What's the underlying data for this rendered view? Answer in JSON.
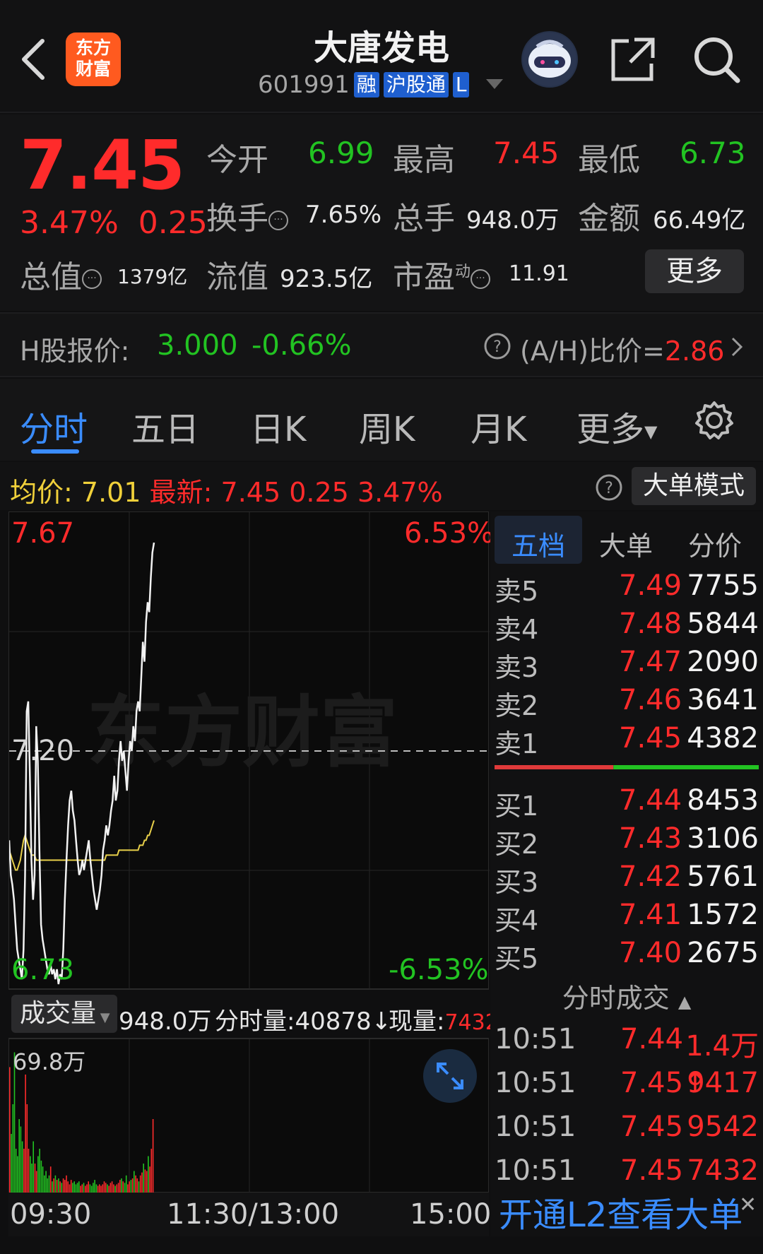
{
  "header": {
    "logo_line1": "东方",
    "logo_line2": "财富",
    "stock_name": "大唐发电",
    "stock_code": "601991",
    "badge1": "融",
    "badge2": "沪股通",
    "badge3": "L"
  },
  "quote": {
    "price": "7.45",
    "change_pct": "3.47%",
    "change_abs": "0.25",
    "open_label": "今开",
    "open": "6.99",
    "high_label": "最高",
    "high": "7.45",
    "low_label": "最低",
    "low": "6.73",
    "turnover_label": "换手",
    "turnover": "7.65%",
    "volume_label": "总手",
    "volume": "948.0万",
    "amount_label": "金额",
    "amount": "66.49亿",
    "mktcap_label": "总值",
    "mktcap": "1379亿",
    "float_label": "流值",
    "float": "923.5亿",
    "pe_label": "市盈",
    "pe_sup": "动",
    "pe": "11.91",
    "more": "更多"
  },
  "hk": {
    "label": "H股报价:",
    "price": "3.000",
    "pct": "-0.66%",
    "ratio_label": "(A/H)比价=",
    "ratio": "2.86"
  },
  "tabs": [
    "分时",
    "五日",
    "日K",
    "周K",
    "月K",
    "更多"
  ],
  "avg_row": {
    "avg_label": "均价:",
    "avg": "7.01",
    "latest_label": "最新:",
    "latest": "7.45",
    "chg": "0.25",
    "pct": "3.47%",
    "big_order_mode": "大单模式"
  },
  "chart_axes": {
    "top_price": "7.67",
    "mid_price": "7.20",
    "bottom_price": "6.73",
    "top_pct": "6.53%",
    "bottom_pct": "-6.53%",
    "watermark": "东方财富"
  },
  "chart_data": {
    "type": "line",
    "ylim": [
      6.73,
      7.67
    ],
    "x_points": 240,
    "series": [
      {
        "values": [
          7.02,
          6.95,
          6.93,
          6.9,
          6.85,
          6.8,
          6.78,
          6.76,
          6.74,
          6.8,
          6.95,
          7.28,
          7.3,
          7.15,
          6.98,
          6.9,
          6.95,
          7.25,
          7.18,
          7.0,
          6.85,
          6.82,
          6.8,
          6.78,
          6.76,
          6.75,
          6.77,
          6.75,
          6.76,
          6.74,
          6.76,
          6.73,
          6.75,
          6.74,
          6.8,
          6.9,
          6.98,
          7.05,
          7.1,
          7.12,
          7.08,
          7.06,
          7.02,
          6.98,
          6.95,
          6.96,
          6.98,
          6.96,
          6.98,
          7.0,
          7.02,
          6.98,
          6.95,
          6.92,
          6.9,
          6.88,
          6.9,
          6.92,
          6.95,
          7.0,
          7.02,
          7.05,
          7.03,
          7.05,
          7.08,
          7.1,
          7.15,
          7.1,
          7.12,
          7.18,
          7.22,
          7.18,
          7.2,
          7.16,
          7.12,
          7.18,
          7.22,
          7.2,
          7.25,
          7.22,
          7.28,
          7.3,
          7.28,
          7.35,
          7.42,
          7.38,
          7.46,
          7.5,
          7.48,
          7.55,
          7.6,
          7.62
        ]
      },
      {
        "values": [
          7.0,
          6.99,
          6.98,
          6.97,
          6.96,
          6.96,
          6.97,
          6.98,
          7.0,
          7.02,
          7.03,
          7.02,
          7.01,
          7.0,
          6.99,
          6.99,
          6.99,
          6.98,
          6.98,
          6.98,
          6.98,
          6.98,
          6.98,
          6.98,
          6.98,
          6.98,
          6.98,
          6.98,
          6.98,
          6.98,
          6.98,
          6.98,
          6.98,
          6.98,
          6.98,
          6.98,
          6.98,
          6.98,
          6.98,
          6.98,
          6.98,
          6.98,
          6.98,
          6.98,
          6.98,
          6.98,
          6.98,
          6.98,
          6.98,
          6.98,
          6.98,
          6.98,
          6.98,
          6.98,
          6.98,
          6.98,
          6.98,
          6.98,
          6.98,
          6.98,
          6.98,
          6.99,
          6.99,
          6.99,
          6.99,
          6.99,
          6.99,
          6.99,
          6.99,
          7.0,
          7.0,
          7.0,
          7.0,
          7.0,
          7.0,
          7.0,
          7.0,
          7.0,
          7.0,
          7.0,
          7.0,
          7.0,
          7.01,
          7.01,
          7.01,
          7.02,
          7.02,
          7.03,
          7.03,
          7.04,
          7.05,
          7.06
        ]
      }
    ],
    "volume": [
      0.85,
      0.4,
      0.6,
      0.95,
      0.3,
      0.25,
      0.5,
      0.45,
      0.35,
      0.3,
      0.8,
      0.6,
      0.3,
      0.25,
      0.2,
      0.35,
      0.2,
      0.15,
      0.25,
      0.3,
      0.22,
      0.18,
      0.12,
      0.15,
      0.1,
      0.12,
      0.18,
      0.08,
      0.1,
      0.12,
      0.09,
      0.1,
      0.08,
      0.07,
      0.1,
      0.09,
      0.12,
      0.08,
      0.06,
      0.09,
      0.07,
      0.08,
      0.06,
      0.07,
      0.08,
      0.05,
      0.06,
      0.07,
      0.05,
      0.06,
      0.08,
      0.06,
      0.05,
      0.07,
      0.09,
      0.06,
      0.05,
      0.06,
      0.05,
      0.06,
      0.08,
      0.07,
      0.06,
      0.05,
      0.07,
      0.08,
      0.06,
      0.05,
      0.06,
      0.07,
      0.09,
      0.1,
      0.08,
      0.07,
      0.12,
      0.06,
      0.08,
      0.09,
      0.1,
      0.15,
      0.12,
      0.1,
      0.08,
      0.12,
      0.14,
      0.2,
      0.16,
      0.15,
      0.25,
      0.18,
      0.3,
      0.5
    ]
  },
  "volume_panel": {
    "selector": "成交量",
    "total": "948.0万",
    "minute_vol": "分时量:40878↓",
    "current_label": "现量:",
    "current": "7432",
    "max": "69.8万"
  },
  "time_axis": [
    "09:30",
    "11:30/13:00",
    "15:00"
  ],
  "book": {
    "tabs": [
      "五档",
      "大单",
      "分价"
    ],
    "asks": [
      {
        "label": "卖5",
        "price": "7.49",
        "vol": "7755"
      },
      {
        "label": "卖4",
        "price": "7.48",
        "vol": "5844"
      },
      {
        "label": "卖3",
        "price": "7.47",
        "vol": "2090"
      },
      {
        "label": "卖2",
        "price": "7.46",
        "vol": "3641"
      },
      {
        "label": "卖1",
        "price": "7.45",
        "vol": "4382"
      }
    ],
    "bids": [
      {
        "label": "买1",
        "price": "7.44",
        "vol": "8453"
      },
      {
        "label": "买2",
        "price": "7.43",
        "vol": "3106"
      },
      {
        "label": "买3",
        "price": "7.42",
        "vol": "5761"
      },
      {
        "label": "买4",
        "price": "7.41",
        "vol": "1572"
      },
      {
        "label": "买5",
        "price": "7.40",
        "vol": "2675"
      }
    ],
    "ask_bid_ratio": 0.45,
    "trades_title": "分时成交",
    "trades": [
      {
        "time": "10:51",
        "price": "7.44",
        "vol": "1.4万"
      },
      {
        "time": "10:51",
        "price": "7.45↑",
        "vol": "9417"
      },
      {
        "time": "10:51",
        "price": "7.45",
        "vol": "9542"
      },
      {
        "time": "10:51",
        "price": "7.45",
        "vol": "7432"
      }
    ],
    "l2_banner": "开通L2查看大单"
  },
  "colors": {
    "up": "#ff2b2b",
    "down": "#22c322",
    "price_line": "#f2f2f2",
    "avg_line": "#e8d04a",
    "accent": "#3a8cff"
  }
}
